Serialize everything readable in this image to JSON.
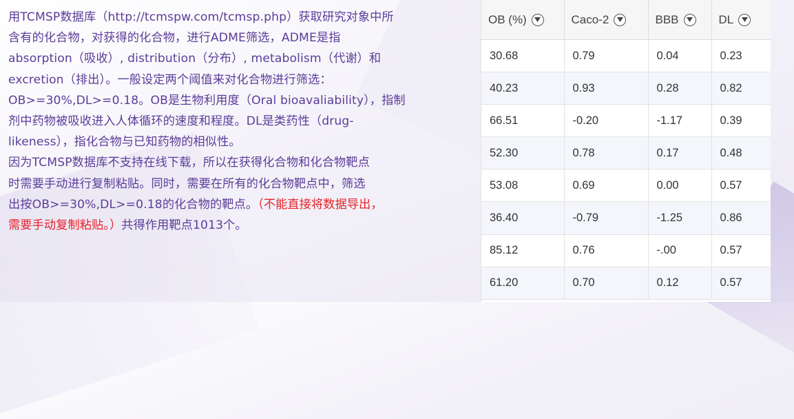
{
  "text": {
    "lines": [
      "用TCMSP数据库（http://tcmspw.com/tcmsp.php）获取研究对象中所",
      "含有的化合物，对获得的化合物，进行ADME筛选，ADME是指",
      "absorption（吸收）, distribution（分布）, metabolism（代谢）和",
      "excretion（排出）。一般设定两个阈值来对化合物进行筛选：",
      "OB>=30%,DL>=0.18。OB是生物利用度（Oral bioavaliability），指制",
      "剂中药物被吸收进入人体循环的速度和程度。DL是类药性（drug-",
      "likeness），指化合物与已知药物的相似性。",
      "因为TCMSP数据库不支持在线下载，所以在获得化合物和化合物靶点",
      "时需要手动进行复制粘贴。同时，需要在所有的化合物靶点中，筛选"
    ],
    "line10_normal": "出按OB>=30%,DL>=0.18的化合物的靶点。",
    "line10_red": "（不能直接将数据导出，",
    "line11_red": "需要手动复制粘贴。）",
    "line11_normal": "共得作用靶点1013个。"
  },
  "table": {
    "headers": [
      "OB (%)",
      "Caco-2",
      "BBB",
      "DL"
    ],
    "rows": [
      [
        "30.68",
        "0.79",
        "0.04",
        "0.23"
      ],
      [
        "40.23",
        "0.93",
        "0.28",
        "0.82"
      ],
      [
        "66.51",
        "-0.20",
        "-1.17",
        "0.39"
      ],
      [
        "52.30",
        "0.78",
        "0.17",
        "0.48"
      ],
      [
        "53.08",
        "0.69",
        "0.00",
        "0.57"
      ],
      [
        "36.40",
        "-0.79",
        "-1.25",
        "0.86"
      ],
      [
        "85.12",
        "0.76",
        "-.00",
        "0.57"
      ],
      [
        "61.20",
        "0.70",
        "0.12",
        "0.57"
      ]
    ]
  },
  "icons": {
    "filter": "filter-icon"
  },
  "colors": {
    "text_purple": "#5b3d9a",
    "text_red": "#e8222a"
  }
}
